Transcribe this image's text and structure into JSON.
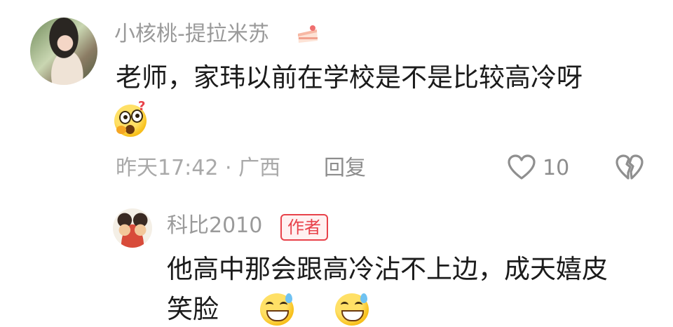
{
  "comment": {
    "username": "小核桃-提拉米苏",
    "badge_icon": "cake-slice-icon",
    "text": "老师，家玮以前在学校是不是比较高冷呀",
    "emoji": "shocked-thinking-emoji",
    "time": "昨天17:42",
    "location": "广西",
    "meta_separator": "·",
    "reply_label": "回复",
    "like_count": "10",
    "like_icon": "heart-outline-icon",
    "dislike_icon": "broken-heart-icon"
  },
  "reply": {
    "username": "科比2010",
    "author_label": "作者",
    "text_line1": "他高中那会跟高冷沾不上边，成天嬉皮",
    "text_line2": "笑脸",
    "emojis": [
      "laughing-sweat-emoji",
      "laughing-sweat-emoji"
    ]
  },
  "colors": {
    "accent_red": "#e8424a",
    "secondary_text": "#9a9a9a",
    "primary_text": "#1b1b1b"
  }
}
